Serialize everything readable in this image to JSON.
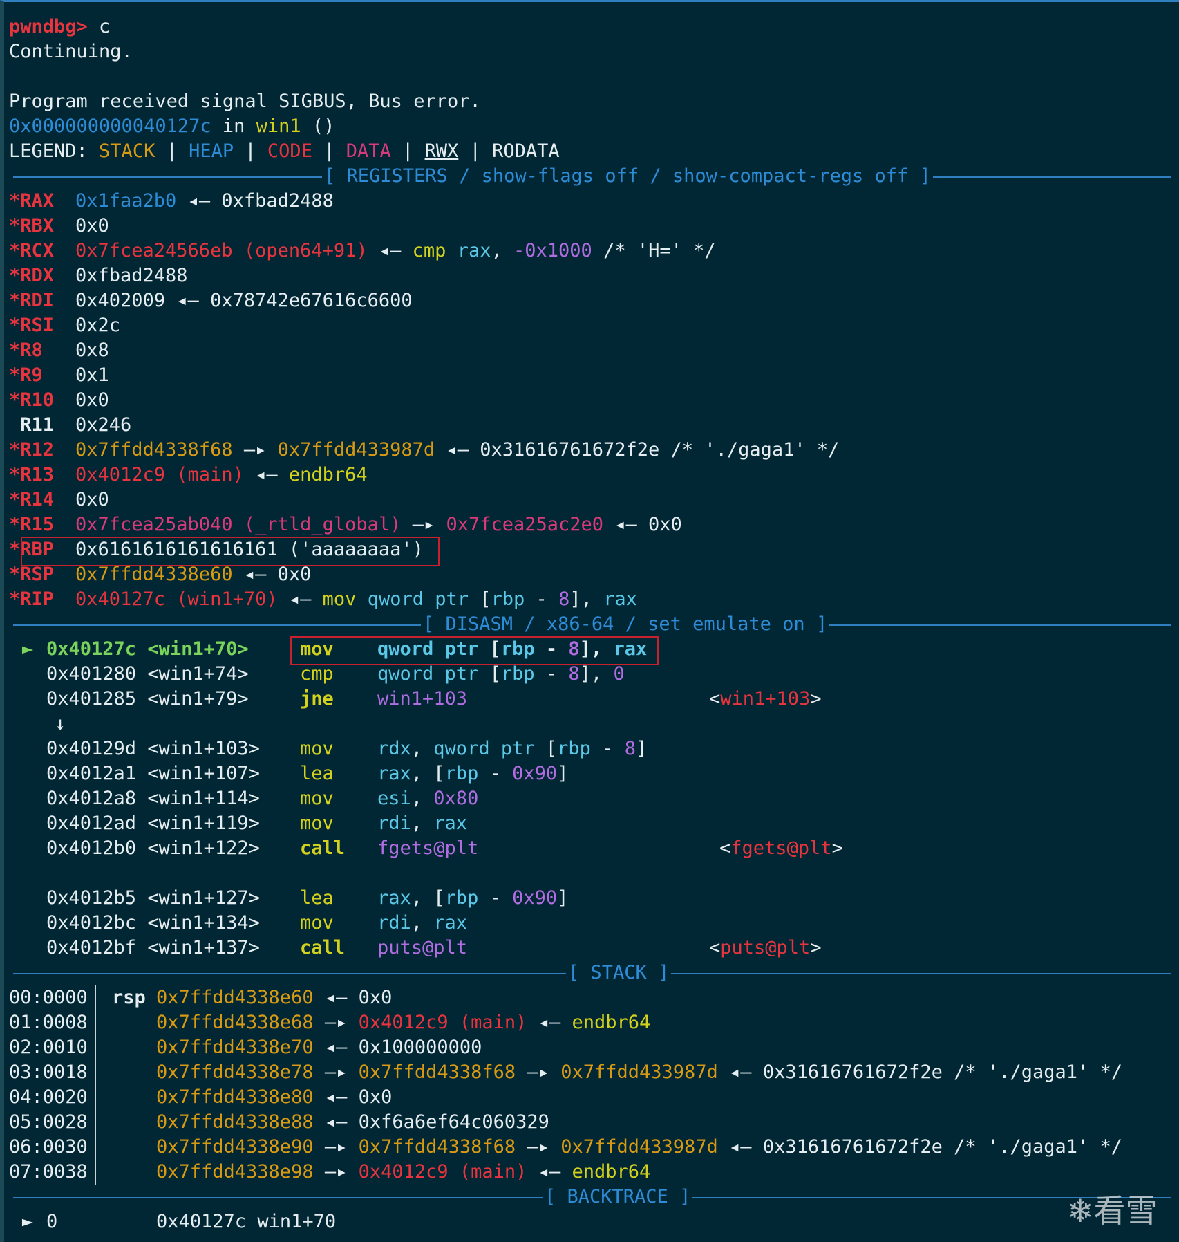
{
  "header": {
    "prompt": "pwndbg>",
    "command": " c",
    "continuing": "Continuing.",
    "signal": "Program received signal SIGBUS, Bus error.",
    "loc_addr": "0x000000000040127c",
    "loc_in": " in ",
    "loc_fn": "win1",
    "loc_paren": " ()"
  },
  "legend": {
    "label": "LEGEND: ",
    "stack": "STACK",
    "heap": "HEAP",
    "code": "CODE",
    "data": "DATA",
    "rwx": "RWX",
    "rodata": "RODATA",
    "sep": " | "
  },
  "sections": {
    "registers": "[ REGISTERS / show-flags off / show-compact-regs off ]",
    "disasm": "[ DISASM / x86-64 / set emulate on ]",
    "stack": "[ STACK ]",
    "backtrace": "[ BACKTRACE ]"
  },
  "registers": [
    {
      "name": "*RAX",
      "parts": [
        [
          "blue",
          "0x1faa2b0"
        ],
        [
          "wht",
          " ◂— 0xfbad2488"
        ]
      ]
    },
    {
      "name": "*RBX",
      "parts": [
        [
          "wht",
          "0x0"
        ]
      ]
    },
    {
      "name": "*RCX",
      "parts": [
        [
          "red",
          "0x7fcea24566eb (open64+91)"
        ],
        [
          "wht",
          " ◂— "
        ],
        [
          "yellow",
          "cmp"
        ],
        [
          "wht",
          " "
        ],
        [
          "cyan",
          "rax"
        ],
        [
          "wht",
          ", "
        ],
        [
          "purple",
          "-0x1000"
        ],
        [
          "wht",
          " /* 'H=' */"
        ]
      ]
    },
    {
      "name": "*RDX",
      "parts": [
        [
          "wht",
          "0xfbad2488"
        ]
      ]
    },
    {
      "name": "*RDI",
      "parts": [
        [
          "wht",
          "0x402009 ◂— 0x78742e67616c6600"
        ]
      ]
    },
    {
      "name": "*RSI",
      "parts": [
        [
          "wht",
          "0x2c"
        ]
      ]
    },
    {
      "name": "*R8",
      "parts": [
        [
          "wht",
          "0x8"
        ]
      ]
    },
    {
      "name": "*R9",
      "parts": [
        [
          "wht",
          "0x1"
        ]
      ]
    },
    {
      "name": "*R10",
      "parts": [
        [
          "wht",
          "0x0"
        ]
      ]
    },
    {
      "name": " R11",
      "plain": true,
      "parts": [
        [
          "wht",
          "0x246"
        ]
      ]
    },
    {
      "name": "*R12",
      "parts": [
        [
          "orange",
          "0x7ffdd4338f68"
        ],
        [
          "wht",
          " —▸ "
        ],
        [
          "orange",
          "0x7ffdd433987d"
        ],
        [
          "wht",
          " ◂— 0x31616761672f2e /* './gaga1' */"
        ]
      ]
    },
    {
      "name": "*R13",
      "parts": [
        [
          "red",
          "0x4012c9 (main)"
        ],
        [
          "wht",
          " ◂— "
        ],
        [
          "yellow",
          "endbr64"
        ]
      ]
    },
    {
      "name": "*R14",
      "parts": [
        [
          "wht",
          "0x0"
        ]
      ]
    },
    {
      "name": "*R15",
      "parts": [
        [
          "pink",
          "0x7fcea25ab040 (_rtld_global)"
        ],
        [
          "wht",
          " —▸ "
        ],
        [
          "pink",
          "0x7fcea25ac2e0"
        ],
        [
          "wht",
          " ◂— 0x0"
        ]
      ]
    },
    {
      "name": "*RBP",
      "parts": [
        [
          "wht",
          "0x6161616161616161 ('aaaaaaaa')"
        ]
      ]
    },
    {
      "name": "*RSP",
      "parts": [
        [
          "orange",
          "0x7ffdd4338e60"
        ],
        [
          "wht",
          " ◂— 0x0"
        ]
      ]
    },
    {
      "name": "*RIP",
      "parts": [
        [
          "red",
          "0x40127c (win1+70)"
        ],
        [
          "wht",
          " ◂— "
        ],
        [
          "yellow",
          "mov"
        ],
        [
          "wht",
          " "
        ],
        [
          "cyan",
          "qword ptr"
        ],
        [
          "wht",
          " ["
        ],
        [
          "cyan",
          "rbp"
        ],
        [
          "wht",
          " - "
        ],
        [
          "purple",
          "8"
        ],
        [
          "wht",
          "], "
        ],
        [
          "cyan",
          "rax"
        ]
      ]
    }
  ],
  "disasm": [
    {
      "marker": "►",
      "addr": "0x40127c",
      "sym": "<win1+70>",
      "op": "mov",
      "current": true,
      "args": [
        [
          "cyan",
          "qword ptr"
        ],
        [
          "wht",
          " ["
        ],
        [
          "cyan",
          "rbp"
        ],
        [
          "wht",
          " - "
        ],
        [
          "purple",
          "8"
        ],
        [
          "wht",
          "], "
        ],
        [
          "cyan",
          "rax"
        ]
      ],
      "target": null
    },
    {
      "marker": "",
      "addr": "0x401280",
      "sym": "<win1+74>",
      "op": "cmp",
      "args": [
        [
          "cyan",
          "qword ptr"
        ],
        [
          "wht",
          " ["
        ],
        [
          "cyan",
          "rbp"
        ],
        [
          "wht",
          " - "
        ],
        [
          "purple",
          "8"
        ],
        [
          "wht",
          "], "
        ],
        [
          "purple",
          "0"
        ]
      ],
      "target": null
    },
    {
      "marker": "",
      "addr": "0x401285",
      "sym": "<win1+79>",
      "op": "jne",
      "opbold": true,
      "args": [
        [
          "purple",
          "win1+103"
        ]
      ],
      "target": "win1+103"
    },
    {
      "marker": "↓",
      "arrowOnly": true
    },
    {
      "marker": "",
      "addr": "0x40129d",
      "sym": "<win1+103>",
      "op": "mov",
      "args": [
        [
          "cyan",
          "rdx"
        ],
        [
          "wht",
          ", "
        ],
        [
          "cyan",
          "qword ptr"
        ],
        [
          "wht",
          " ["
        ],
        [
          "cyan",
          "rbp"
        ],
        [
          "wht",
          " - "
        ],
        [
          "purple",
          "8"
        ],
        [
          "wht",
          "]"
        ]
      ],
      "target": null
    },
    {
      "marker": "",
      "addr": "0x4012a1",
      "sym": "<win1+107>",
      "op": "lea",
      "args": [
        [
          "cyan",
          "rax"
        ],
        [
          "wht",
          ", ["
        ],
        [
          "cyan",
          "rbp"
        ],
        [
          "wht",
          " - "
        ],
        [
          "purple",
          "0x90"
        ],
        [
          "wht",
          "]"
        ]
      ],
      "target": null
    },
    {
      "marker": "",
      "addr": "0x4012a8",
      "sym": "<win1+114>",
      "op": "mov",
      "args": [
        [
          "cyan",
          "esi"
        ],
        [
          "wht",
          ", "
        ],
        [
          "purple",
          "0x80"
        ]
      ],
      "target": null
    },
    {
      "marker": "",
      "addr": "0x4012ad",
      "sym": "<win1+119>",
      "op": "mov",
      "args": [
        [
          "cyan",
          "rdi"
        ],
        [
          "wht",
          ", "
        ],
        [
          "cyan",
          "rax"
        ]
      ],
      "target": null
    },
    {
      "marker": "",
      "addr": "0x4012b0",
      "sym": "<win1+122>",
      "op": "call",
      "opbold": true,
      "args": [
        [
          "purple",
          "fgets@plt"
        ]
      ],
      "target": "fgets@plt"
    },
    {
      "blank": true
    },
    {
      "marker": "",
      "addr": "0x4012b5",
      "sym": "<win1+127>",
      "op": "lea",
      "args": [
        [
          "cyan",
          "rax"
        ],
        [
          "wht",
          ", ["
        ],
        [
          "cyan",
          "rbp"
        ],
        [
          "wht",
          " - "
        ],
        [
          "purple",
          "0x90"
        ],
        [
          "wht",
          "]"
        ]
      ],
      "target": null
    },
    {
      "marker": "",
      "addr": "0x4012bc",
      "sym": "<win1+134>",
      "op": "mov",
      "args": [
        [
          "cyan",
          "rdi"
        ],
        [
          "wht",
          ", "
        ],
        [
          "cyan",
          "rax"
        ]
      ],
      "target": null
    },
    {
      "marker": "",
      "addr": "0x4012bf",
      "sym": "<win1+137>",
      "op": "call",
      "opbold": true,
      "args": [
        [
          "purple",
          "puts@plt"
        ]
      ],
      "target": "puts@plt"
    }
  ],
  "stack": [
    {
      "idx": "00:0000",
      "reg": "rsp",
      "parts": [
        [
          "orange",
          "0x7ffdd4338e60"
        ],
        [
          "wht",
          " ◂— 0x0"
        ]
      ]
    },
    {
      "idx": "01:0008",
      "reg": "",
      "parts": [
        [
          "orange",
          "0x7ffdd4338e68"
        ],
        [
          "wht",
          " —▸ "
        ],
        [
          "red",
          "0x4012c9 (main)"
        ],
        [
          "wht",
          " ◂— "
        ],
        [
          "yellow",
          "endbr64"
        ]
      ]
    },
    {
      "idx": "02:0010",
      "reg": "",
      "parts": [
        [
          "orange",
          "0x7ffdd4338e70"
        ],
        [
          "wht",
          " ◂— 0x100000000"
        ]
      ]
    },
    {
      "idx": "03:0018",
      "reg": "",
      "parts": [
        [
          "orange",
          "0x7ffdd4338e78"
        ],
        [
          "wht",
          " —▸ "
        ],
        [
          "orange",
          "0x7ffdd4338f68"
        ],
        [
          "wht",
          " —▸ "
        ],
        [
          "orange",
          "0x7ffdd433987d"
        ],
        [
          "wht",
          " ◂— 0x31616761672f2e /* './gaga1' */"
        ]
      ]
    },
    {
      "idx": "04:0020",
      "reg": "",
      "parts": [
        [
          "orange",
          "0x7ffdd4338e80"
        ],
        [
          "wht",
          " ◂— 0x0"
        ]
      ]
    },
    {
      "idx": "05:0028",
      "reg": "",
      "parts": [
        [
          "orange",
          "0x7ffdd4338e88"
        ],
        [
          "wht",
          " ◂— 0xf6a6ef64c060329"
        ]
      ]
    },
    {
      "idx": "06:0030",
      "reg": "",
      "parts": [
        [
          "orange",
          "0x7ffdd4338e90"
        ],
        [
          "wht",
          " —▸ "
        ],
        [
          "orange",
          "0x7ffdd4338f68"
        ],
        [
          "wht",
          " —▸ "
        ],
        [
          "orange",
          "0x7ffdd433987d"
        ],
        [
          "wht",
          " ◂— 0x31616761672f2e /* './gaga1' */"
        ]
      ]
    },
    {
      "idx": "07:0038",
      "reg": "",
      "parts": [
        [
          "orange",
          "0x7ffdd4338e98"
        ],
        [
          "wht",
          " —▸ "
        ],
        [
          "red",
          "0x4012c9 (main)"
        ],
        [
          "wht",
          " ◂— "
        ],
        [
          "yellow",
          "endbr64"
        ]
      ]
    }
  ],
  "backtrace": [
    {
      "marker": "►",
      "num": "0",
      "addr": "0x40127c",
      "fn": "win1+70"
    }
  ],
  "watermark": "❄看雪"
}
